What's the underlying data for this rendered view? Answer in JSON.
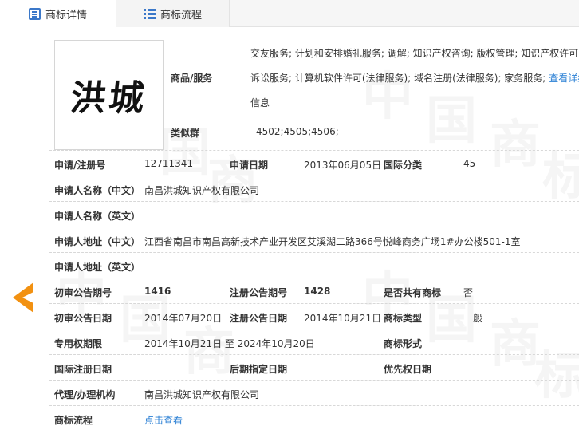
{
  "tabs": {
    "detail": "商标详情",
    "flow": "商标流程"
  },
  "watermark": {
    "chars": [
      "中",
      "国",
      "商",
      "标"
    ]
  },
  "logo": {
    "text": "洪城"
  },
  "goods": {
    "label": "商品/服务",
    "line1": "交友服务; 计划和安排婚礼服务; 调解; 知识产权咨询; 版权管理; 知识产权许可;",
    "line2": "诉讼服务; 计算机软件许可(法律服务); 域名注册(法律服务); 家务服务;",
    "link_part1": "查看详细",
    "link_part2": "信息"
  },
  "similar_group": {
    "label": "类似群",
    "value": "4502;4505;4506;"
  },
  "rows": {
    "reg_no_label": "申请/注册号",
    "reg_no": "12711341",
    "app_date_label": "申请日期",
    "app_date": "2013年06月05日",
    "intl_class_label": "国际分类",
    "intl_class": "45",
    "applicant_cn_label": "申请人名称（中文）",
    "applicant_cn": "南昌洪城知识产权有限公司",
    "applicant_en_label": "申请人名称（英文）",
    "applicant_en": "",
    "address_cn_label": "申请人地址（中文）",
    "address_cn": "江西省南昌市南昌高新技术产业开发区艾溪湖二路366号悦峰商务广场1#办公楼501-1室",
    "address_en_label": "申请人地址（英文）",
    "address_en": "",
    "prelim_no_label": "初审公告期号",
    "prelim_no": "1416",
    "reg_pub_no_label": "注册公告期号",
    "reg_pub_no": "1428",
    "shared_label": "是否共有商标",
    "shared": "否",
    "prelim_date_label": "初审公告日期",
    "prelim_date": "2014年07月20日",
    "reg_pub_date_label": "注册公告日期",
    "reg_pub_date": "2014年10月21日",
    "tm_type_label": "商标类型",
    "tm_type": "一般",
    "exclusive_label": "专用权期限",
    "exclusive": "2014年10月21日 至 2024年10月20日",
    "tm_form_label": "商标形式",
    "tm_form": "",
    "intl_reg_date_label": "国际注册日期",
    "intl_reg_date": "",
    "later_date_label": "后期指定日期",
    "later_date": "",
    "priority_label": "优先权日期",
    "priority": "",
    "agent_label": "代理/办理机构",
    "agent": "南昌洪城知识产权有限公司",
    "flow_label": "商标流程",
    "flow_link": "点击查看"
  },
  "colors": {
    "link": "#2a7fd4",
    "arrow": "#f29111",
    "tab_icon": "#3b78c9"
  }
}
